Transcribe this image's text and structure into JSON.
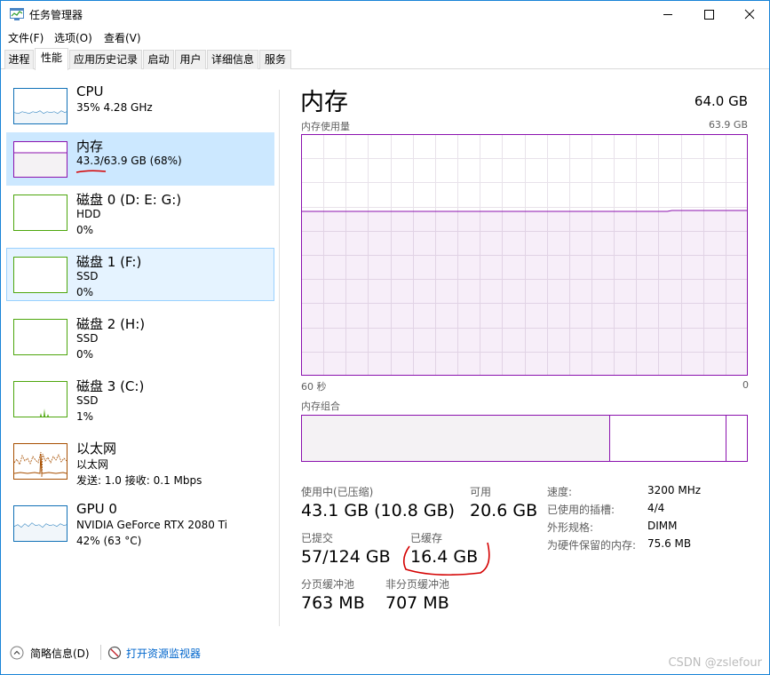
{
  "window": {
    "title": "任务管理器"
  },
  "menu": [
    "文件(F)",
    "选项(O)",
    "查看(V)"
  ],
  "tabs": [
    "进程",
    "性能",
    "应用历史记录",
    "启动",
    "用户",
    "详细信息",
    "服务"
  ],
  "active_tab": "性能",
  "sidebar": [
    {
      "name": "CPU",
      "line1": "35% 4.28 GHz",
      "line2": ""
    },
    {
      "name": "内存",
      "line1": "43.3/63.9 GB (68%)",
      "line2": ""
    },
    {
      "name": "磁盘 0 (D: E: G:)",
      "line1": "HDD",
      "line2": "0%"
    },
    {
      "name": "磁盘 1 (F:)",
      "line1": "SSD",
      "line2": "0%"
    },
    {
      "name": "磁盘 2 (H:)",
      "line1": "SSD",
      "line2": "0%"
    },
    {
      "name": "磁盘 3 (C:)",
      "line1": "SSD",
      "line2": "1%"
    },
    {
      "name": "以太网",
      "line1": "以太网",
      "line2": "发送: 1.0  接收: 0.1 Mbps"
    },
    {
      "name": "GPU 0",
      "line1": "NVIDIA GeForce RTX 2080 Ti",
      "line2": "42% (63 °C)"
    }
  ],
  "main": {
    "title": "内存",
    "total": "64.0 GB",
    "usage_label": "内存使用量",
    "usage_max": "63.9 GB",
    "usage_fraction": 0.68,
    "axis_left": "60 秒",
    "axis_right": "0",
    "composition_label": "内存组合",
    "composition": {
      "in_use_fraction": 0.69,
      "modified_fraction": 0.0,
      "standby_fraction": 0.26,
      "free_fraction": 0.05
    },
    "stats": {
      "in_use_label": "使用中(已压缩)",
      "in_use": "43.1 GB (10.8 GB)",
      "available_label": "可用",
      "available": "20.6 GB",
      "committed_label": "已提交",
      "committed": "57/124 GB",
      "cached_label": "已缓存",
      "cached": "16.4 GB",
      "paged_label": "分页缓冲池",
      "paged": "763 MB",
      "nonpaged_label": "非分页缓冲池",
      "nonpaged": "707 MB"
    },
    "specs": {
      "speed_label": "速度:",
      "speed": "3200 MHz",
      "slots_label": "已使用的插槽:",
      "slots": "4/4",
      "form_label": "外形规格:",
      "form": "DIMM",
      "reserved_label": "为硬件保留的内存:",
      "reserved": "75.6 MB"
    }
  },
  "footer": {
    "fewer_details": "简略信息(D)",
    "open_monitor": "打开资源监视器"
  },
  "watermark": "CSDN @zslefour",
  "colors": {
    "memory": "#8b12ae",
    "cpu": "#1171b7",
    "disk": "#4da60c",
    "ethernet": "#a74f01",
    "selected": "#cce8ff",
    "hover": "#e5f3ff",
    "annotation": "#d40000"
  }
}
